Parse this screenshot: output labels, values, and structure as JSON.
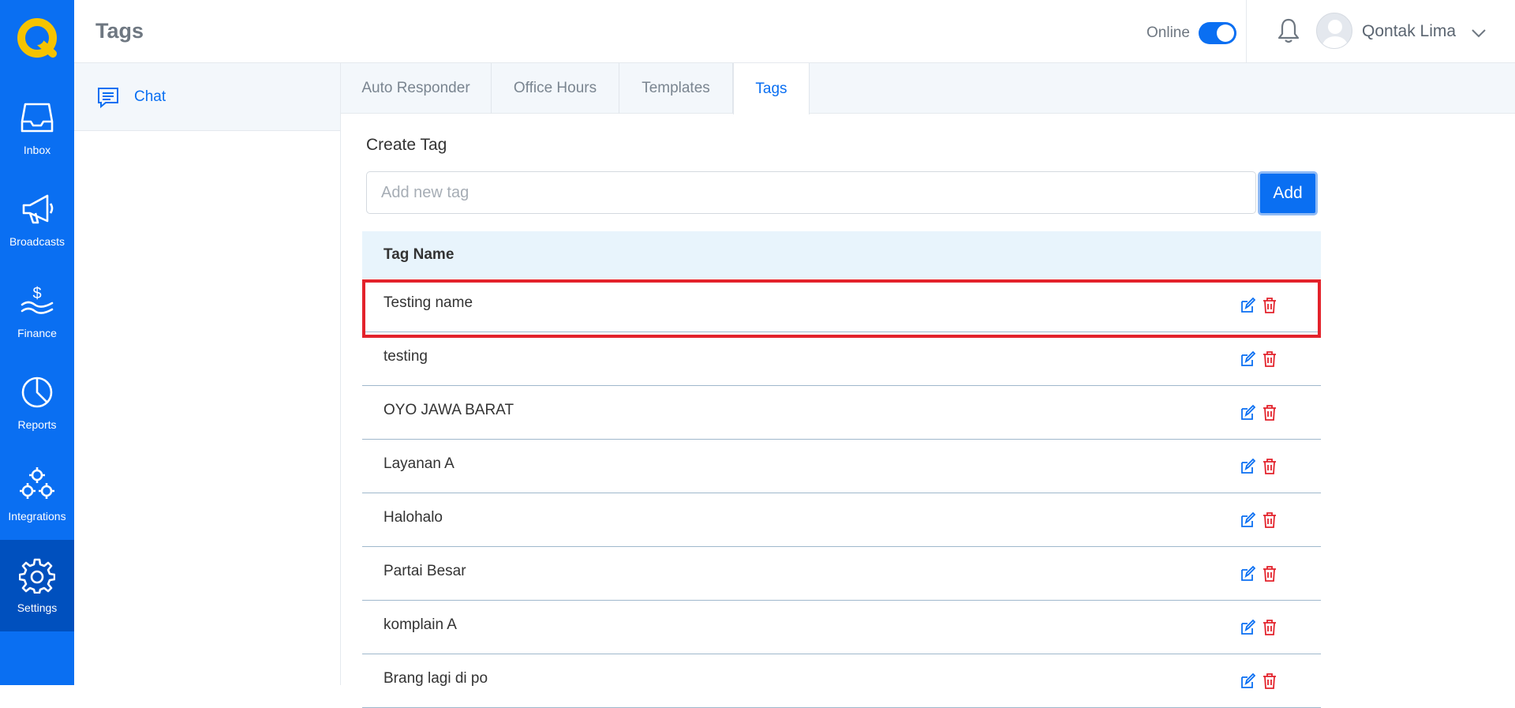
{
  "app": {
    "brand_color": "#0a6ff2",
    "logo_color": "#f5c300"
  },
  "rail": {
    "items": [
      {
        "label": "Inbox",
        "icon": "inbox-icon"
      },
      {
        "label": "Broadcasts",
        "icon": "megaphone-icon"
      },
      {
        "label": "Finance",
        "icon": "finance-icon"
      },
      {
        "label": "Reports",
        "icon": "pie-chart-icon"
      },
      {
        "label": "Integrations",
        "icon": "integrations-icon"
      },
      {
        "label": "Settings",
        "icon": "gear-icon",
        "active": true
      }
    ]
  },
  "header": {
    "title": "Tags",
    "online_label": "Online",
    "online": true,
    "user_name": "Qontak Lima"
  },
  "subsidebar": {
    "items": [
      {
        "label": "Chat",
        "icon": "chat-icon",
        "active": true
      }
    ]
  },
  "tabs": [
    {
      "label": "Auto Responder"
    },
    {
      "label": "Office Hours"
    },
    {
      "label": "Templates"
    },
    {
      "label": "Tags",
      "active": true
    }
  ],
  "create": {
    "title": "Create Tag",
    "placeholder": "Add new tag",
    "value": "",
    "add_label": "Add"
  },
  "table": {
    "header": "Tag Name",
    "rows": [
      {
        "name": "Testing name",
        "highlighted": true
      },
      {
        "name": "testing"
      },
      {
        "name": "OYO JAWA BARAT"
      },
      {
        "name": "Layanan A"
      },
      {
        "name": "Halohalo"
      },
      {
        "name": "Partai Besar"
      },
      {
        "name": "komplain A"
      },
      {
        "name": "Brang lagi di po"
      }
    ]
  }
}
